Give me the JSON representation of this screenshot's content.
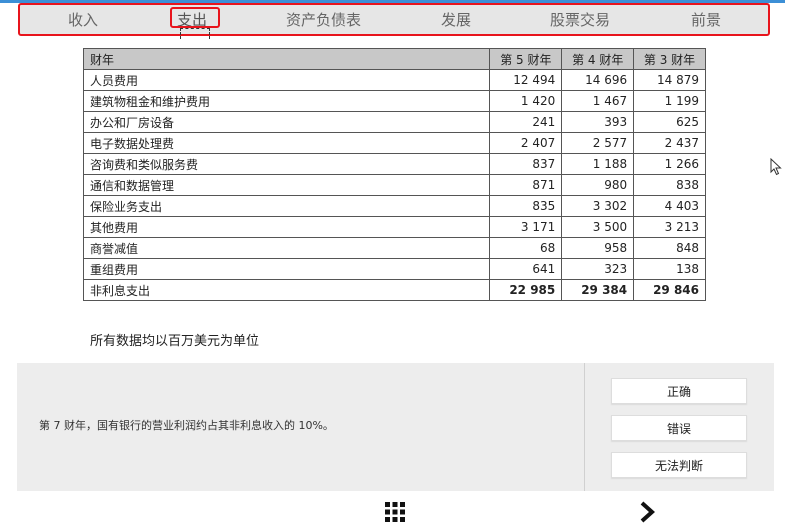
{
  "nav": {
    "tabs": [
      {
        "label": "收入"
      },
      {
        "label": "支出",
        "active": true
      },
      {
        "label": "资产负债表"
      },
      {
        "label": "发展"
      },
      {
        "label": "股票交易"
      },
      {
        "label": "前景"
      }
    ]
  },
  "table": {
    "headers": [
      "财年",
      "第 5 财年",
      "第 4 财年",
      "第 3 财年"
    ],
    "rows": [
      {
        "label": "人员费用",
        "y5": "12 494",
        "y4": "14 696",
        "y3": "14 879"
      },
      {
        "label": "建筑物租金和维护费用",
        "y5": "1 420",
        "y4": "1 467",
        "y3": "1 199"
      },
      {
        "label": "办公和厂房设备",
        "y5": "241",
        "y4": "393",
        "y3": "625"
      },
      {
        "label": "电子数据处理费",
        "y5": "2 407",
        "y4": "2 577",
        "y3": "2 437"
      },
      {
        "label": "咨询费和类似服务费",
        "y5": "837",
        "y4": "1 188",
        "y3": "1 266"
      },
      {
        "label": "通信和数据管理",
        "y5": "871",
        "y4": "980",
        "y3": "838"
      },
      {
        "label": "保险业务支出",
        "y5": "835",
        "y4": "3 302",
        "y3": "4 403"
      },
      {
        "label": "其他费用",
        "y5": "3 171",
        "y4": "3 500",
        "y3": "3 213"
      },
      {
        "label": "商誉减值",
        "y5": "68",
        "y4": "958",
        "y3": "848"
      },
      {
        "label": "重组费用",
        "y5": "641",
        "y4": "323",
        "y3": "138"
      },
      {
        "label": "非利息支出",
        "y5": "22 985",
        "y4": "29 384",
        "y3": "29 846"
      }
    ]
  },
  "note": "所有数据均以百万美元为单位",
  "question": "第 7 财年，国有银行的营业利润约占其非利息收入的 10%。",
  "answers": {
    "true_label": "正确",
    "false_label": "错误",
    "cannot_label": "无法判断"
  },
  "icons": {
    "grid": "grid-icon",
    "next": "chevron-right-icon",
    "cursor": "mouse-cursor-icon"
  },
  "colors": {
    "highlight_red": "#e8141c",
    "nav_bg": "#e6e6e6",
    "table_header_bg": "#c8c8c8",
    "panel_bg": "#ededed",
    "top_strip": "#3c8fd6"
  }
}
